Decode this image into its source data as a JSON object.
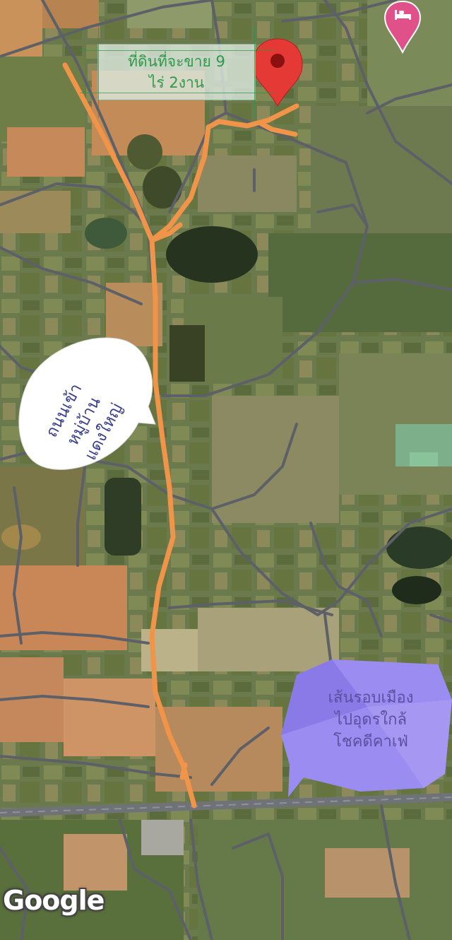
{
  "map": {
    "attribution": "Google",
    "view": "satellite"
  },
  "annotations": {
    "land_for_sale": {
      "line1": "ที่ดินที่จะขาย 9",
      "line2": "ไร่ 2งาน"
    },
    "village_road": {
      "line1": "ถนนเข้า",
      "line2": "หมู่บ้าน",
      "line3": "แดงใหญ่"
    },
    "ring_road": {
      "line1": "เส้นรอบเมือง",
      "line2": "ไปอุดรใกล้",
      "line3": "โชคดีคาเฟ่"
    }
  },
  "markers": {
    "location_pin": {
      "color": "#e53935",
      "icon": "map-pin-icon"
    },
    "hotel_pin": {
      "color": "#e0518a",
      "icon": "bed-icon"
    }
  },
  "colors": {
    "route": "#f0944a",
    "road": "#5d6167",
    "village_bubble": "#ffffff",
    "ring_bubble": "#9a8cf0"
  }
}
